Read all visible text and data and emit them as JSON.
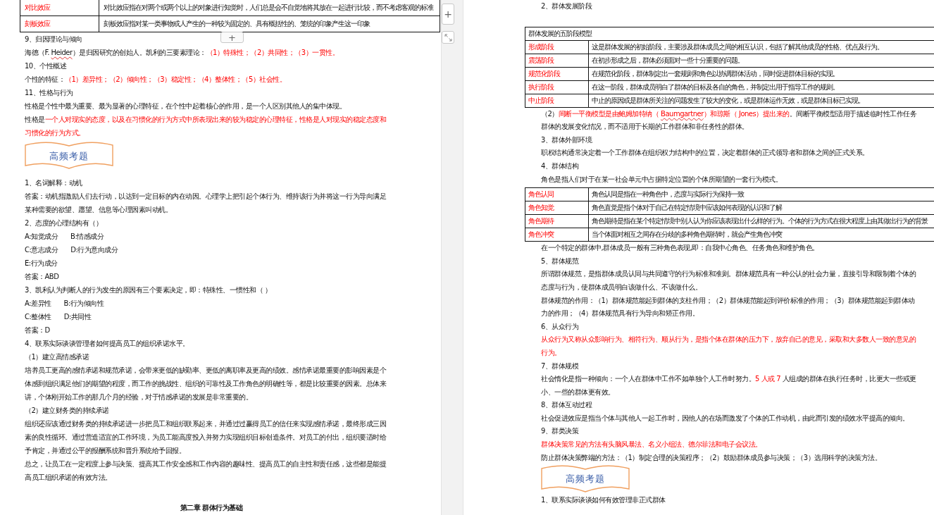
{
  "pages": [
    {
      "blocks": [
        {
          "kind": "table",
          "rows": [
            {
              "term": "对比效应",
              "definition": "对比效应指在对两个或两个以上的对象进行知觉时，人们总是会不自觉地将其放在一起进行比较，而不考虑客观的标准"
            },
            {
              "term": "刻板效应",
              "definition": "刻板效应指对某一类事物或人产生的一种较为固定的、具有概括性的、笼统的印象产生这一印象"
            }
          ]
        },
        {
          "kind": "heading",
          "text": "9、归因理论与倾向"
        },
        {
          "kind": "para",
          "runs": [
            {
              "text": "海德（F. ",
              "emphasis": false,
              "misspelled": false
            },
            {
              "text": "Heider",
              "emphasis": false,
              "misspelled": true
            },
            {
              "text": "）是归因研究的创始人。凯利的三要素理论：",
              "emphasis": false,
              "misspelled": false
            },
            {
              "text": "（1）特殊性；（2）共同性；（3）一贯性。",
              "emphasis": true,
              "misspelled": false
            }
          ]
        },
        {
          "kind": "heading",
          "text": "10、个性概述"
        },
        {
          "kind": "para",
          "runs": [
            {
              "text": "个性的特征：",
              "emphasis": false,
              "misspelled": false
            },
            {
              "text": "（1）差异性；（2）倾向性；（3）稳定性；（4）整体性；（5）社会性。",
              "emphasis": true,
              "misspelled": false
            }
          ]
        },
        {
          "kind": "heading",
          "text": "11、性格与行为"
        },
        {
          "kind": "para",
          "text": "性格是个性中最为重要、最为显著的心理特征，在个性中起着核心的作用，是一个人区别其他人的集中体现。"
        },
        {
          "kind": "para",
          "runs": [
            {
              "text": "性格是",
              "emphasis": false,
              "misspelled": false
            },
            {
              "text": "一个人对现实的态度，以及在习惯化的行为方式中所表现出来的较为稳定的心理特征，性格是人对现实的稳定态度和习惯化的行为方式。",
              "emphasis": true,
              "misspelled": false
            }
          ]
        },
        {
          "kind": "banner",
          "text": "高频考题"
        },
        {
          "kind": "para",
          "text": "1、名词解释：动机"
        },
        {
          "kind": "para",
          "text": "答案：动机指激励人们去行动，以达到一定目标的内在动因。心理学上把引起个体行为、维持该行为并将这一行为导向满足某种需要的欲望、愿望、信息等心理因素叫动机。"
        },
        {
          "kind": "para",
          "text": "2、态度的心理结构有（）"
        },
        {
          "kind": "options",
          "items": [
            "A:知觉成分",
            "B:情感成分"
          ]
        },
        {
          "kind": "options",
          "items": [
            "C:意志成分",
            "D:行为意向成分"
          ]
        },
        {
          "kind": "options",
          "items": [
            "E:行为成分"
          ]
        },
        {
          "kind": "para",
          "text": "答案：ABD"
        },
        {
          "kind": "para",
          "text": "3、凯利认为判断人的行为发生的原因有三个要素决定，即：特殊性、一惯性和（ ）"
        },
        {
          "kind": "options",
          "items": [
            "A:差异性",
            "B:行为倾向性"
          ]
        },
        {
          "kind": "options",
          "items": [
            "C:整体性",
            "D:共同性"
          ]
        },
        {
          "kind": "para",
          "text": "答案：D"
        },
        {
          "kind": "para",
          "text": "4、联系实际谈谈管理者如何提高员工的组织承诺水平。"
        },
        {
          "kind": "para",
          "text": "（1）建立高情感承诺"
        },
        {
          "kind": "para",
          "text": "培养员工更高的感情承诺和规范承诺，会带来更低的缺勤率、更低的离职率及更高的绩效。感情承诺最重要的影响因素是个体感到组织满足他们的期望的程度，而工作的挑战性、组织的可靠性及工作角色的明确性等，都是比较重要的因素。总体来讲，个体刚开始工作的那几个月的经验，对于情感承诺的发展是非常重要的。"
        },
        {
          "kind": "para",
          "text": "（2）建立财务类的持续承诺"
        },
        {
          "kind": "para",
          "text": "组织还应该通过财务类的持续承诺进一步把员工和组织联系起来，并通过过赢得员工的信任来实现感情承诺，最终形成三因素的良性循环。通过营造适宜的工作环境，为员工能高度投入并努力实现组织目标创造条件。对员工的付出，组织要适时给予肯定，并通过公平的报酬系统和晋升系统给予回报。"
        },
        {
          "kind": "para",
          "text": "总之，让员工在一定程度上参与决策、提高其工作安全感和工作内容的趣味性、提高员工的自主性和责任感，这些都是能提高员工组织承诺的有效方法。"
        },
        {
          "kind": "chapter",
          "text": "第二章 群体行为基础"
        }
      ]
    },
    {
      "blocks": [
        {
          "kind": "heading",
          "text": "2、群体发展阶段"
        },
        {
          "kind": "table",
          "caption": "群体发展的五阶段模型",
          "rows": [
            {
              "term": "形成阶段",
              "definition": "这是群体发展的初始阶段，主要涉及群体成员之间的相互认识，包括了解其他成员的性格、优点及行为。"
            },
            {
              "term": "震荡阶段",
              "definition": "在初步形成之后，群体必须面对一些十分重要的问题。"
            },
            {
              "term": "规范化阶段",
              "definition": "在规范化阶段，群体制定出一套规则和角色以协调群体活动，同时促进群体目标的实现。"
            },
            {
              "term": "执行阶段",
              "definition": "在这一阶段，群体成员明白了群体的目标及各自的角色，并制定出用于指导工作的规则。"
            },
            {
              "term": "中止阶段",
              "definition": "中止的原因或是群体所关注的问题发生了较大的变化，或是群体运作无效，或是群体目标已实现。"
            }
          ]
        },
        {
          "kind": "para",
          "runs": [
            {
              "text": "（2）",
              "emphasis": false,
              "misspelled": false
            },
            {
              "text": "间断一平衡模型是由鲍姆加特纳（ ",
              "emphasis": true,
              "misspelled": false
            },
            {
              "text": "Baumgartner",
              "emphasis": true,
              "misspelled": true
            },
            {
              "text": "）和琼斯（ Jones）提出来的",
              "emphasis": true,
              "misspelled": false
            },
            {
              "text": "。间断平衡模型适用于描述临时性工作任务群体的发展变化情况，而不适用于长期的工作群体和非任务性的群体。",
              "emphasis": false,
              "misspelled": false
            }
          ]
        },
        {
          "kind": "heading",
          "text": "3、群体外部环境"
        },
        {
          "kind": "para",
          "text": "职权结构通常决定着一个工作群体在组织权力结构中的位置，决定着群体的正式领导者和群体之间的正式关系。"
        },
        {
          "kind": "heading",
          "text": "4、群体结构"
        },
        {
          "kind": "para",
          "text": "角色是指人们对于在某一社会单元中占据特定位置的个体所期望的一套行为模式。"
        },
        {
          "kind": "table",
          "rows": [
            {
              "term": "角色认同",
              "definition": "角色认同是指在一种角色中，态度与实际行为保持一致"
            },
            {
              "term": "角色知觉",
              "definition": "角色直觉是指个体对于自己在特定情境中应该如何表现的认识和了解"
            },
            {
              "term": "角色期待",
              "definition": "角色期待是指在某个特定情境中别人认为你应该表现出什么样的行为。个体的行为方式在很大程度上由其做出行为的背景"
            },
            {
              "term": "角色冲突",
              "definition": "当个体面对相互之间存在分歧的多种角色期待时，就会产生角色冲突"
            }
          ]
        },
        {
          "kind": "para",
          "text": "在一个特定的群体中,群体成员一般有三种角色表现,即：自我中心角色、任务角色和维护角色。"
        },
        {
          "kind": "heading",
          "text": "5、群体规范"
        },
        {
          "kind": "para",
          "text": "所谓群体规范，是指群体成员认同与共同遵守的行为标准和准则。群体规范具有一种公认的社会力量，直接引导和限制着个体的态度与行为，使群体成员明白该做什么、不该做什么。"
        },
        {
          "kind": "para",
          "text": "群体规范的作用：（1）群体规范能起到群体的支柱作用；（2）群体规范能起到评价标准的作用；（3）群体规范能起到群体动力的作用；（4）群体规范具有行为导向和矫正作用。"
        },
        {
          "kind": "heading",
          "text": "6、从众行为"
        },
        {
          "kind": "para",
          "runs": [
            {
              "text": "从众行为又称从众影响行为、相符行为、顺从行为，是指个体在群体的压力下，放弃自己的意见，采取和大多数人一致的意见的行为。",
              "emphasis": true,
              "misspelled": false
            }
          ]
        },
        {
          "kind": "heading",
          "text": "7、群体规模"
        },
        {
          "kind": "para",
          "runs": [
            {
              "text": "社会惰化是指一种倾向：一个人在群体中工作不如单独个人工作时努力。",
              "emphasis": false,
              "misspelled": false
            },
            {
              "text": "5 人或 7 ",
              "emphasis": true,
              "misspelled": false
            },
            {
              "text": "人组成的群体在执行任务时，比更大一些或更小、一些的群体更有效。",
              "emphasis": false,
              "misspelled": false
            }
          ]
        },
        {
          "kind": "heading",
          "text": "8、群体互动过程"
        },
        {
          "kind": "para",
          "text": "社会促进效应是指当个体与其他人一起工作时，因他人的在场而激发了个体的工作动机，由此而引发的绩效水平提高的倾向。"
        },
        {
          "kind": "heading",
          "text": "9、群类决策"
        },
        {
          "kind": "para",
          "runs": [
            {
              "text": "群体决策常见的方法有头脑风暴法、名义小组法、德尔菲法和电子会议法。",
              "emphasis": true,
              "misspelled": false
            }
          ]
        },
        {
          "kind": "para",
          "text": "防止群体决策弊端的方法：（1）制定合理的决策程序；（2）鼓励群体成员参与决策；（3）选用科学的决策方法。"
        },
        {
          "kind": "banner",
          "text": "高频考题"
        },
        {
          "kind": "last",
          "text": "1、联系实际谈谈如何有效管理非正式群体"
        }
      ]
    }
  ],
  "tools": {
    "add_row": "+",
    "add_side": "+"
  }
}
